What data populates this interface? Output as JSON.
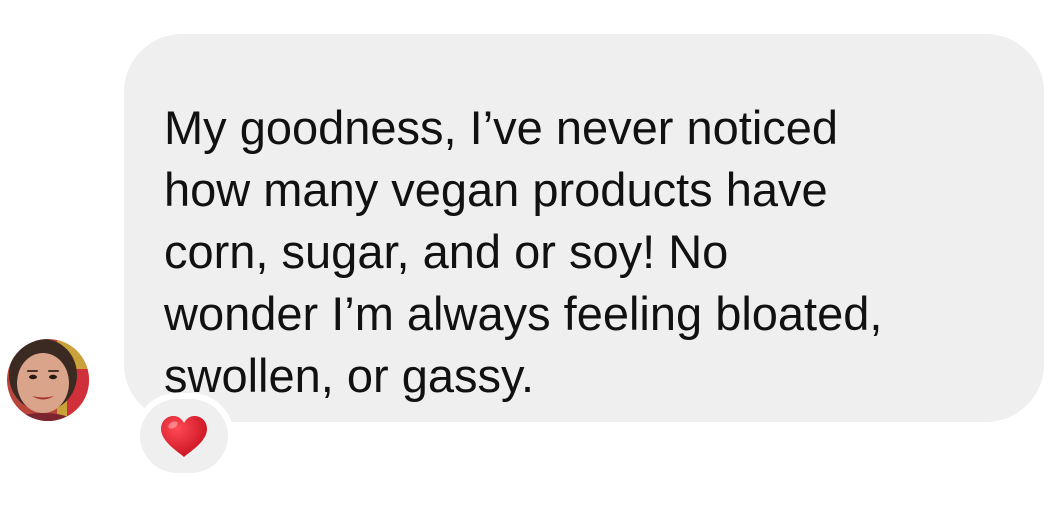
{
  "message": {
    "text": "My goodness,  I’ve never noticed\nhow many vegan products have\ncorn, sugar, and or soy!  No\nwonder I’m always feeling bloated,\nswollen, or gassy."
  },
  "reaction": {
    "icon": "heart-icon",
    "color": "#d8192b"
  },
  "avatar": {
    "icon": "user-avatar"
  },
  "colors": {
    "bubble_background": "#efefef",
    "text": "#111111",
    "background": "#ffffff"
  }
}
